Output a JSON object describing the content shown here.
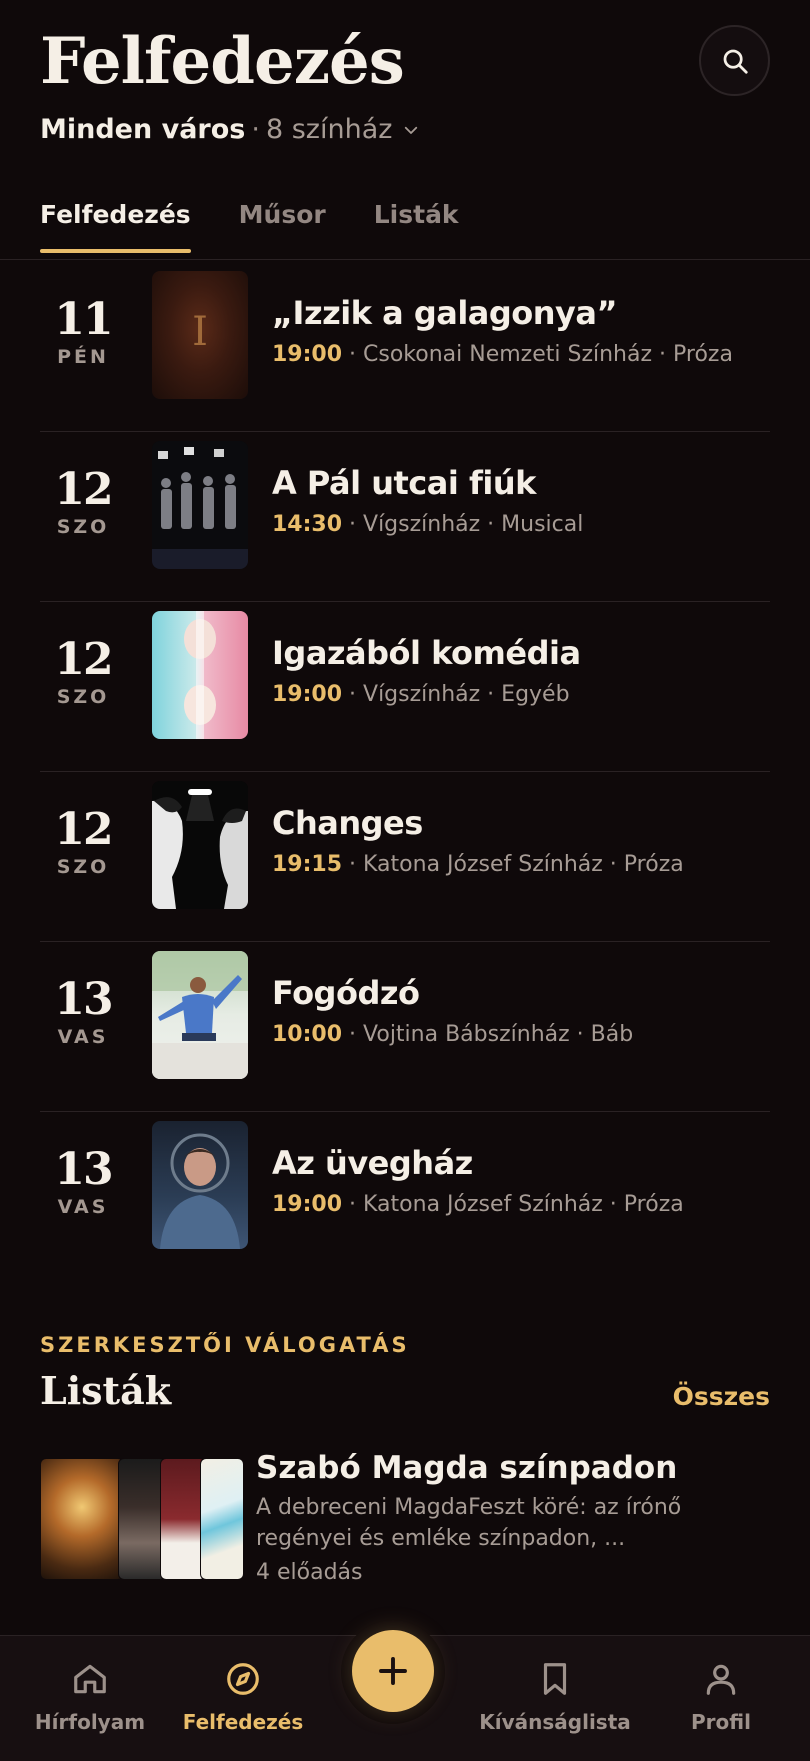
{
  "header": {
    "title": "Felfedezés",
    "city": "Minden város",
    "separator": "·",
    "theaters": "8 színház"
  },
  "tabs": [
    {
      "label": "Felfedezés",
      "active": true
    },
    {
      "label": "Műsor",
      "active": false
    },
    {
      "label": "Listák",
      "active": false
    }
  ],
  "events": [
    {
      "day": "11",
      "weekday": "PÉN",
      "title": "„Izzik a galagonya”",
      "time": "19:00",
      "details": "· Csokonai Nemzeti Színház · Próza"
    },
    {
      "day": "12",
      "weekday": "SZO",
      "title": "A Pál utcai fiúk",
      "time": "14:30",
      "details": "· Vígszínház · Musical"
    },
    {
      "day": "12",
      "weekday": "SZO",
      "title": "Igazából komédia",
      "time": "19:00",
      "details": "· Vígszínház · Egyéb"
    },
    {
      "day": "12",
      "weekday": "SZO",
      "title": "Changes",
      "time": "19:15",
      "details": "· Katona József Színház · Próza"
    },
    {
      "day": "13",
      "weekday": "VAS",
      "title": "Fogódzó",
      "time": "10:00",
      "details": "· Vojtina Bábszínház · Báb"
    },
    {
      "day": "13",
      "weekday": "VAS",
      "title": "Az üvegház",
      "time": "19:00",
      "details": "· Katona József Színház · Próza"
    }
  ],
  "lists_section": {
    "kicker": "SZERKESZTŐI VÁLOGATÁS",
    "title": "Listák",
    "see_all": "Összes",
    "items": [
      {
        "title": "Szabó Magda színpadon",
        "description": "A debreceni MagdaFeszt köré: az írónő regényei és emléke színpadon, ...",
        "count": "4 előadás"
      }
    ]
  },
  "nav": [
    {
      "label": "Hírfolyam",
      "icon": "home-icon",
      "active": false
    },
    {
      "label": "Felfedezés",
      "icon": "compass-icon",
      "active": true
    },
    {
      "label": "Kívánságlista",
      "icon": "bookmark-icon",
      "active": false
    },
    {
      "label": "Profil",
      "icon": "user-icon",
      "active": false
    }
  ],
  "colors": {
    "background": "#0f090a",
    "accent": "#e9bd6b",
    "text": "#f5efe6",
    "muted": "#a79c95"
  }
}
